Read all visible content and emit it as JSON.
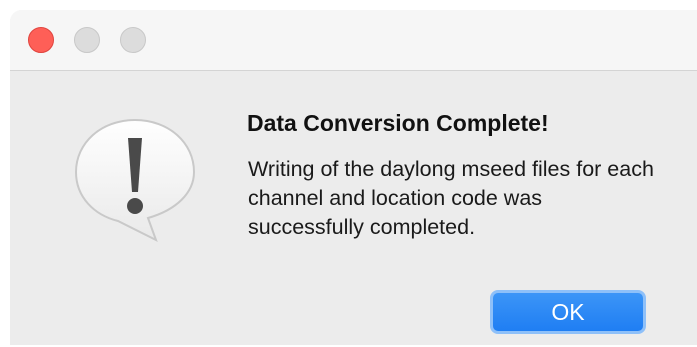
{
  "window": {
    "title_bar_buttons": [
      "close",
      "minimize",
      "zoom"
    ]
  },
  "alert": {
    "icon": "caution-speech-bubble-icon",
    "title": "Data Conversion Complete!",
    "message": "Writing of the daylong mseed files for each channel and location code was successfully completed.",
    "ok_label": "OK"
  },
  "colors": {
    "close_button": "#fe5f57",
    "inactive_button": "#dcdcdc",
    "ok_button": "#2b86f5",
    "dialog_background": "#ececec"
  }
}
